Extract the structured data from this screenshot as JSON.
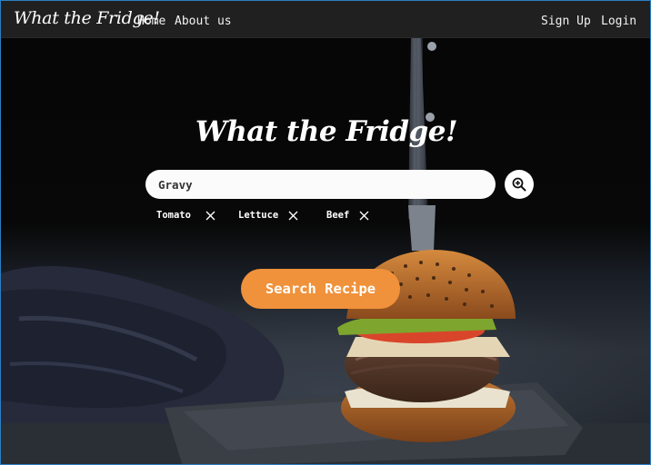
{
  "nav": {
    "brand": "What the Fridge!",
    "links": [
      {
        "label": "Home"
      },
      {
        "label": "About us"
      }
    ],
    "auth": [
      {
        "label": "Sign Up"
      },
      {
        "label": "Login"
      }
    ]
  },
  "hero": {
    "title": "What the Fridge!"
  },
  "search": {
    "value": "Gravy",
    "icon": "zoom-in-icon"
  },
  "ingredients": [
    {
      "label": "Tomato",
      "icon": "close-icon"
    },
    {
      "label": "Lettuce",
      "icon": "close-icon"
    },
    {
      "label": "Beef",
      "icon": "close-icon"
    }
  ],
  "actions": {
    "search_recipe": "Search Recipe"
  },
  "colors": {
    "accent": "#f0923b",
    "navbar": "#202020"
  }
}
